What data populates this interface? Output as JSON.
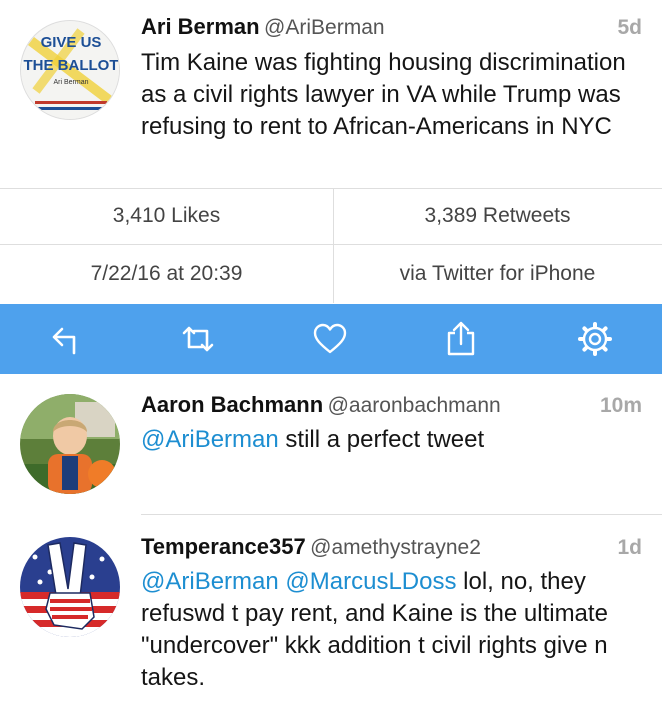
{
  "main_tweet": {
    "name": "Ari Berman",
    "handle": "@AriBerman",
    "time": "5d",
    "text": "Tim Kaine was fighting housing discrimination as a civil rights lawyer in VA while Trump was refusing to rent to African-Americans in NYC",
    "avatar": {
      "line1": "GIVE US",
      "line2": "THE BALLOT",
      "line3": "Ari Berman"
    }
  },
  "stats": {
    "likes": "3,410 Likes",
    "retweets": "3,389 Retweets",
    "date": "7/22/16 at 20:39",
    "source": "via Twitter for iPhone"
  },
  "action_bar": {
    "color": "#4ea1ed",
    "icons": [
      "reply-icon",
      "retweet-icon",
      "heart-icon",
      "share-icon",
      "gear-icon"
    ]
  },
  "replies": [
    {
      "name": "Aaron Bachmann",
      "handle": "@aaronbachmann",
      "time": "10m",
      "mention": "@AriBerman",
      "text": " still a perfect tweet"
    },
    {
      "name": "Temperance357",
      "handle": "@amethystrayne2",
      "time": "1d",
      "mentions": "@AriBerman @MarcusLDoss",
      "text": " lol, no, they refuswd t pay rent, and Kaine is the ultimate \"undercover\" kkk addition t civil rights give n takes."
    }
  ],
  "colors": {
    "mention": "#1d8ed1",
    "time": "#a8a8a8"
  }
}
